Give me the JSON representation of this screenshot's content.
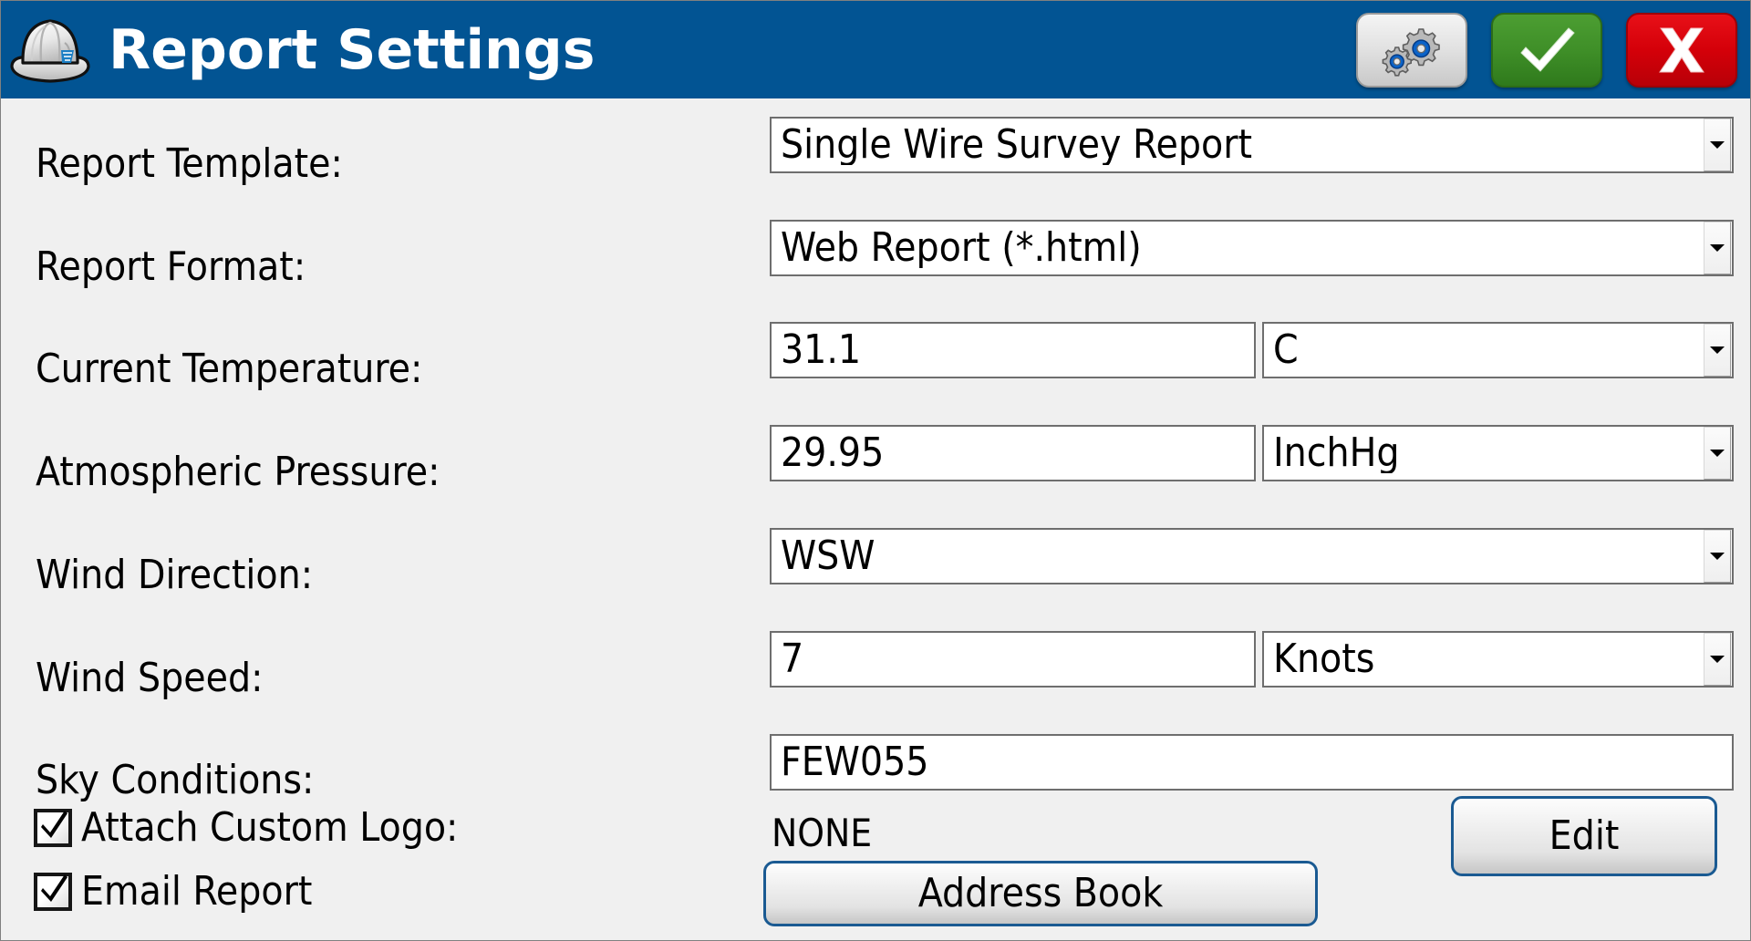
{
  "window": {
    "title": "Report Settings",
    "icon": "hard-hat-icon",
    "header_color": "#025493",
    "body_color": "#f0f0f0"
  },
  "titlebar_buttons": [
    {
      "name": "settings-button",
      "icon": "gears-icon",
      "label": "",
      "color": "#e3e3e3"
    },
    {
      "name": "confirm-button",
      "icon": "checkmark-icon",
      "label": "",
      "color": "#3f8f28"
    },
    {
      "name": "cancel-button",
      "icon": "x-icon",
      "label": "",
      "color": "#d40009"
    }
  ],
  "form": {
    "report_template": {
      "label": "Report Template:",
      "value": "Single Wire Survey Report",
      "control": "combobox"
    },
    "report_format": {
      "label": "Report Format:",
      "value": "Web Report (*.html)",
      "control": "combobox"
    },
    "current_temperature": {
      "label": "Current Temperature:",
      "value": "31.1",
      "unit": "C",
      "control": "text+combobox"
    },
    "atmospheric_pressure": {
      "label": "Atmospheric Pressure:",
      "value": "29.95",
      "unit": "InchHg",
      "control": "text+combobox"
    },
    "wind_direction": {
      "label": "Wind Direction:",
      "value": "WSW",
      "control": "combobox"
    },
    "wind_speed": {
      "label": "Wind Speed:",
      "value": "7",
      "unit": "Knots",
      "control": "text+combobox"
    },
    "sky_conditions": {
      "label": "Sky Conditions:",
      "value": "FEW055",
      "control": "text"
    },
    "attach_custom_logo": {
      "label": "Attach Custom Logo:",
      "checked": true,
      "logo_value": "NONE",
      "edit_label": "Edit"
    },
    "email_report": {
      "label": "Email Report",
      "checked": true,
      "address_book_label": "Address Book"
    }
  }
}
